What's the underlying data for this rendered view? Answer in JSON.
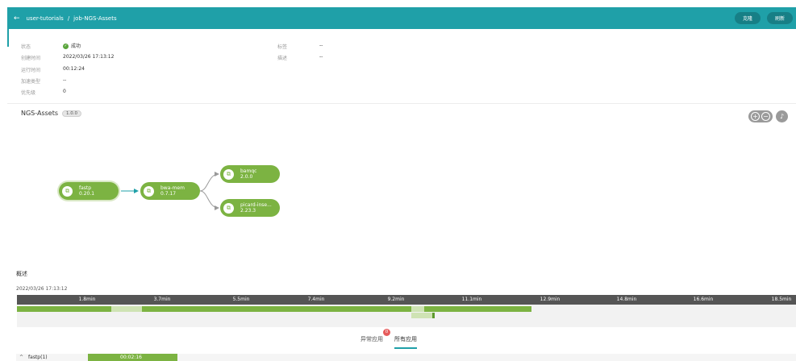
{
  "header": {
    "back_icon": "arrow-left-icon",
    "breadcrumb_root": "user-tutorials",
    "separator": "/",
    "breadcrumb_current": "job-NGS-Assets",
    "btn_clone": "克隆",
    "btn_refresh": "刷新",
    "accent": "#1fa0a8"
  },
  "info": {
    "status_label": "状态",
    "status_value": "成功",
    "created_label": "创建时间",
    "created_value": "2022/03/26 17:13:12",
    "runtime_label": "运行时间",
    "runtime_value": "00:12:24",
    "accel_label": "加速类型",
    "accel_value": "--",
    "priority_label": "优先级",
    "priority_value": "0",
    "tag_label": "标签",
    "tag_value": "--",
    "desc_label": "描述",
    "desc_value": "--"
  },
  "workflow": {
    "name": "NGS-Assets",
    "version": "1.0.0",
    "nodes": [
      {
        "name": "fastp",
        "version": "0.20.1"
      },
      {
        "name": "bwa-mem",
        "version": "0.7.17"
      },
      {
        "name": "bamqc",
        "version": "2.0.0"
      },
      {
        "name": "picard-inse...",
        "version": "2.23.3"
      }
    ],
    "node_color": "#7cb342"
  },
  "overview": {
    "title": "概述",
    "start": "2022/03/26 17:13:12",
    "ticks": [
      "1.8min",
      "3.7min",
      "5.5min",
      "7.4min",
      "9.2min",
      "11.1min",
      "12.9min",
      "14.8min",
      "16.6min",
      "18.5min"
    ]
  },
  "tabs": {
    "abnormal": "异常应用",
    "abnormal_count": "0",
    "all": "所有应用"
  },
  "list": {
    "row_label": "fastp(1)",
    "row_duration": "00:02:16"
  }
}
